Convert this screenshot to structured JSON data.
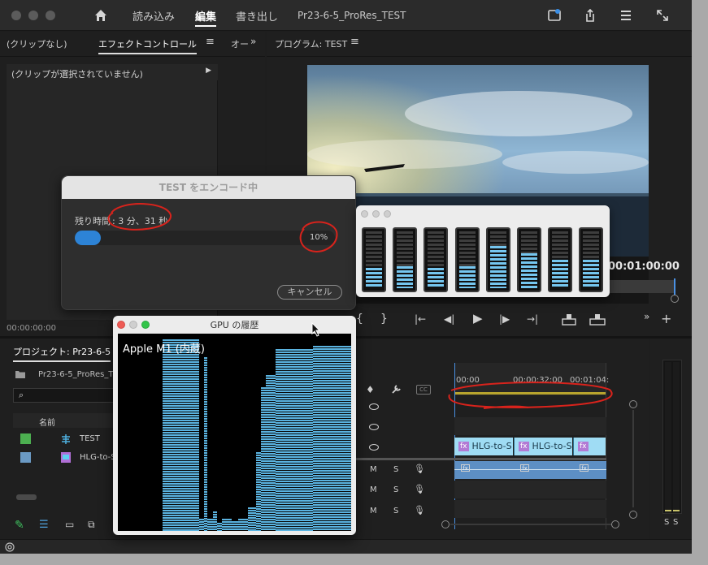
{
  "titlebar": {
    "tabs": [
      "読み込み",
      "編集",
      "書き出し"
    ],
    "project_title": "Pr23-6-5_ProRes_TEST"
  },
  "left_panel": {
    "tab_no_clip": "(クリップなし)",
    "tab_effect_controls": "エフェクトコントロール",
    "tab_audio": "オー",
    "no_clip_selected": "(クリップが選択されていません)",
    "timecode": "00:00:00:00"
  },
  "program_monitor": {
    "title": "プログラム: TEST",
    "timecode": "00:01:00:00"
  },
  "encode_dialog": {
    "title": "TEST をエンコード中",
    "remaining_label": "残り時間",
    "remaining_value": ": 3 分、31 秒",
    "percent_label": "10%",
    "progress": 0.1,
    "cancel": "キャンセル"
  },
  "cpu_meter": {
    "levels": [
      0.35,
      0.38,
      0.35,
      0.38,
      0.72,
      0.6,
      0.48,
      0.48
    ]
  },
  "gpu_history": {
    "title": "GPU の履歴",
    "device": "Apple M1 (内蔵)"
  },
  "project_panel": {
    "title": "プロジェクト: Pr23-6-5",
    "bin_name": "Pr23-6-5_ProRes_TE",
    "column_name": "名前",
    "items": [
      {
        "name": "TEST",
        "color": "#4caf50"
      },
      {
        "name": "HLG-to-S",
        "color": "#6b9ac4"
      }
    ]
  },
  "timeline": {
    "ruler": [
      "00:00",
      "00:00:32:00",
      "00:01:04:"
    ],
    "clip_label": "HLG-to-S",
    "track_m": "M",
    "track_s": "S"
  },
  "audio_meter": {
    "labels": [
      "S",
      "S"
    ]
  }
}
